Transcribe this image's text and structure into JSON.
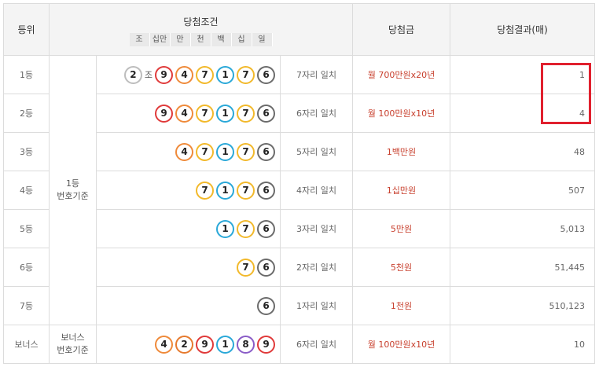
{
  "header": {
    "rank": "등위",
    "condition": "당첨조건",
    "prize": "당첨금",
    "result": "당첨결과(매)",
    "subcols": [
      "조",
      "십만",
      "만",
      "천",
      "백",
      "십",
      "일"
    ]
  },
  "ball_colors": {
    "1": "#2aa8d8",
    "2": "#e67a2e",
    "4": "#ef8a3a",
    "6": "#6b6b6b",
    "7": "#f2b92b",
    "8": "#8a5cc7",
    "9": "#e03a3a",
    "jo": "#bdbdbd"
  },
  "basis_main": [
    "1등",
    "번호기준"
  ],
  "basis_bonus": [
    "보너스",
    "번호기준"
  ],
  "rows": [
    {
      "rank": "1등",
      "jo": "2",
      "jo_label": "조",
      "balls": [
        "9",
        "4",
        "7",
        "1",
        "7",
        "6"
      ],
      "match": "7자리 일치",
      "prize": "월 700만원x20년",
      "count": "1"
    },
    {
      "rank": "2등",
      "jo": null,
      "balls": [
        "9",
        "4",
        "7",
        "1",
        "7",
        "6"
      ],
      "match": "6자리 일치",
      "prize": "월 100만원x10년",
      "count": "4"
    },
    {
      "rank": "3등",
      "jo": null,
      "balls": [
        "4",
        "7",
        "1",
        "7",
        "6"
      ],
      "match": "5자리 일치",
      "prize": "1백만원",
      "count": "48"
    },
    {
      "rank": "4등",
      "jo": null,
      "balls": [
        "7",
        "1",
        "7",
        "6"
      ],
      "match": "4자리 일치",
      "prize": "1십만원",
      "count": "507"
    },
    {
      "rank": "5등",
      "jo": null,
      "balls": [
        "1",
        "7",
        "6"
      ],
      "match": "3자리 일치",
      "prize": "5만원",
      "count": "5,013"
    },
    {
      "rank": "6등",
      "jo": null,
      "balls": [
        "7",
        "6"
      ],
      "match": "2자리 일치",
      "prize": "5천원",
      "count": "51,445"
    },
    {
      "rank": "7등",
      "jo": null,
      "balls": [
        "6"
      ],
      "match": "1자리 일치",
      "prize": "1천원",
      "count": "510,123"
    },
    {
      "rank": "보너스",
      "jo": null,
      "balls": [
        "4",
        "2",
        "9",
        "1",
        "8",
        "9"
      ],
      "match": "6자리 일치",
      "prize": "월 100만원x10년",
      "count": "10"
    }
  ],
  "highlight_color": "#e0202e"
}
